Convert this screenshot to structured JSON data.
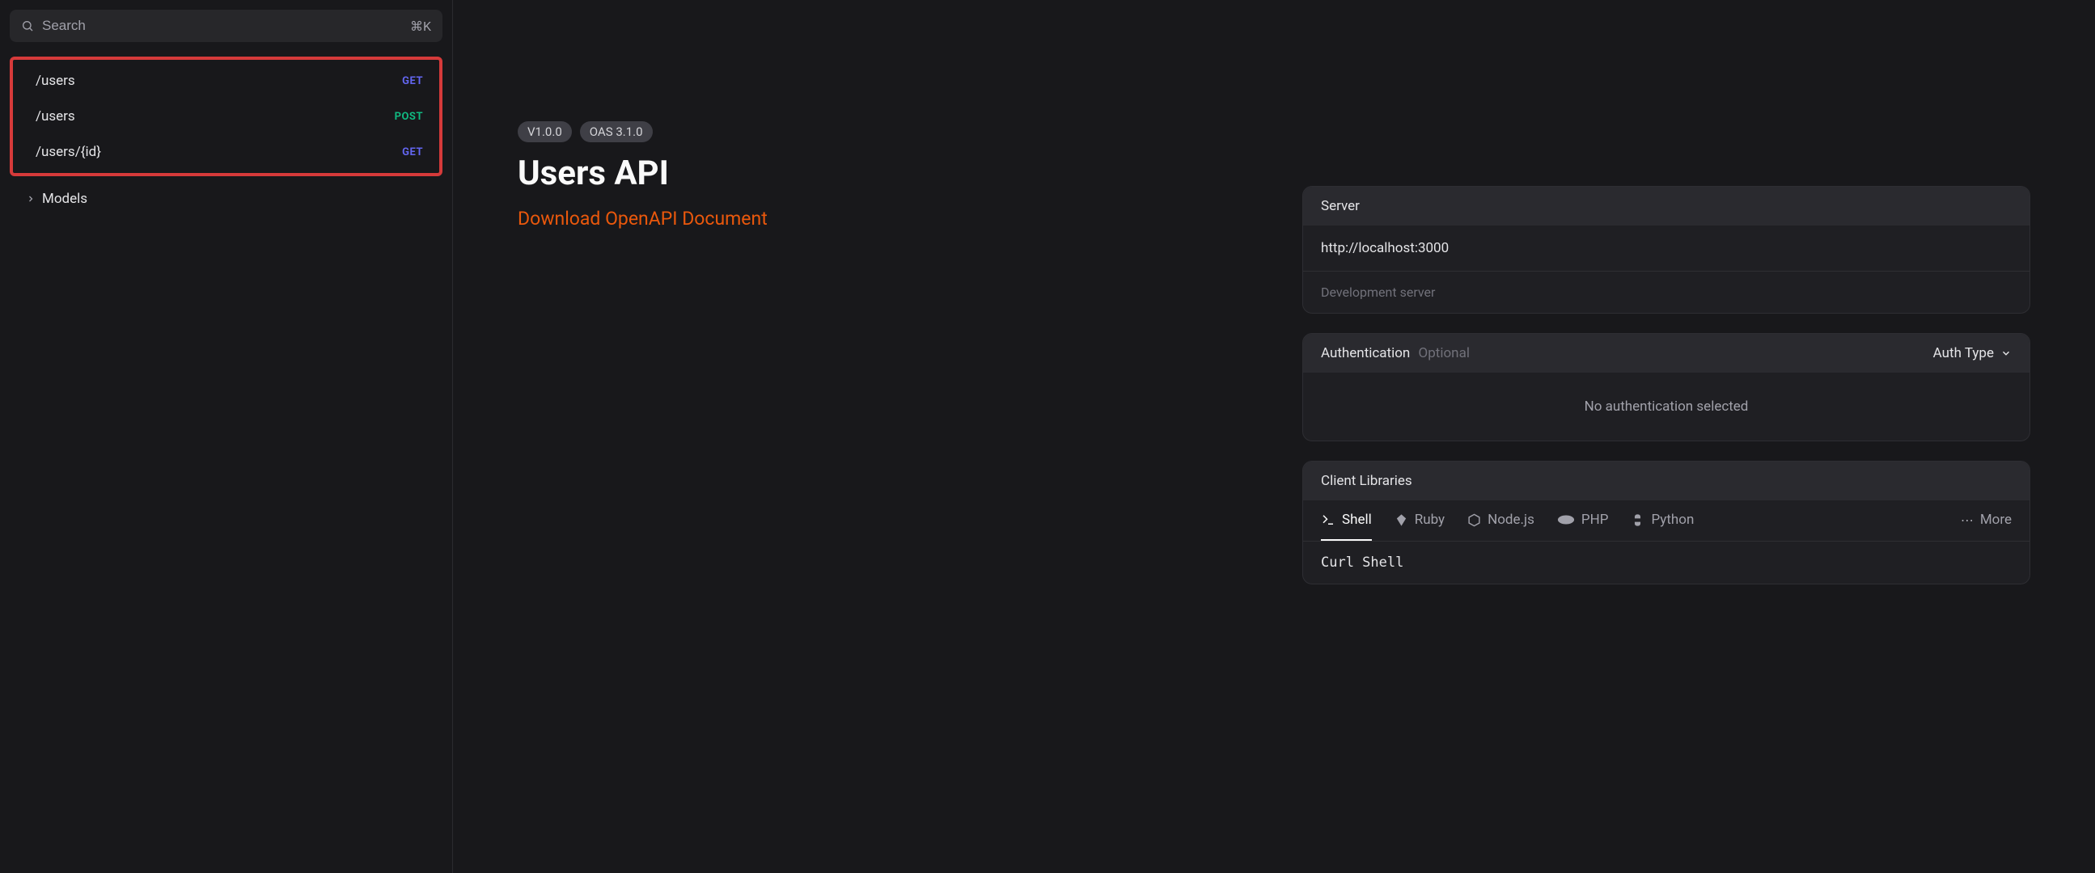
{
  "search": {
    "placeholder": "Search",
    "shortcut": "⌘K"
  },
  "sidebar": {
    "endpoints": [
      {
        "path": "/users",
        "method": "GET"
      },
      {
        "path": "/users",
        "method": "POST"
      },
      {
        "path": "/users/{id}",
        "method": "GET"
      }
    ],
    "models_label": "Models"
  },
  "header": {
    "version_badge": "V1.0.0",
    "oas_badge": "OAS 3.1.0",
    "title": "Users API",
    "download_link": "Download OpenAPI Document"
  },
  "server": {
    "label": "Server",
    "url": "http://localhost:3000",
    "description": "Development server"
  },
  "auth": {
    "label": "Authentication",
    "optional": "Optional",
    "selector_label": "Auth Type",
    "empty_text": "No authentication selected"
  },
  "client_libs": {
    "label": "Client Libraries",
    "tabs": [
      "Shell",
      "Ruby",
      "Node.js",
      "PHP",
      "Python"
    ],
    "more": "More",
    "code": "Curl Shell"
  }
}
